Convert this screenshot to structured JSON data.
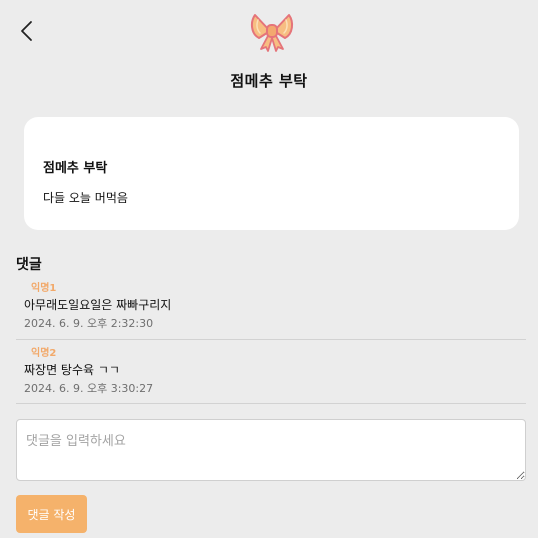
{
  "header": {
    "back_icon": "chevron-left-icon",
    "logo_icon": "ribbon-bow-icon",
    "title": "점메추 부탁"
  },
  "post": {
    "title": "점메추 부탁",
    "body": "다들 오늘 머먹음"
  },
  "comments": {
    "heading": "댓글",
    "items": [
      {
        "author": "익명1",
        "text": "아무래도일요일은 짜빠구리지",
        "time": "2024. 6. 9. 오후 2:32:30"
      },
      {
        "author": "익명2",
        "text": "짜장면 탕수육 ㄱㄱ",
        "time": "2024. 6. 9. 오후 3:30:27"
      }
    ]
  },
  "form": {
    "placeholder": "댓글을 입력하세요",
    "value": "",
    "submit_label": "댓글 작성"
  },
  "colors": {
    "background": "#ececec",
    "accent": "#f5b26b",
    "author": "#f2a96a",
    "card": "#ffffff"
  }
}
